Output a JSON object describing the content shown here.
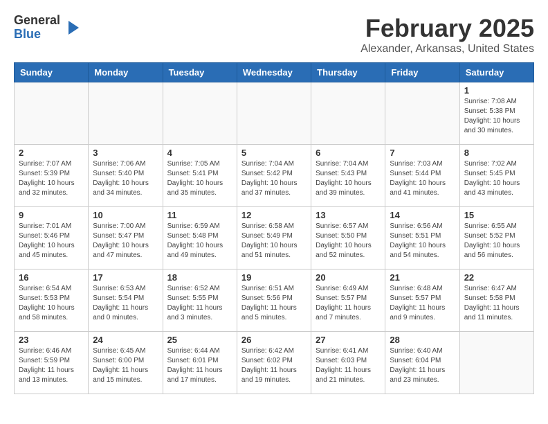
{
  "logo": {
    "general": "General",
    "blue": "Blue"
  },
  "header": {
    "month": "February 2025",
    "location": "Alexander, Arkansas, United States"
  },
  "weekdays": [
    "Sunday",
    "Monday",
    "Tuesday",
    "Wednesday",
    "Thursday",
    "Friday",
    "Saturday"
  ],
  "weeks": [
    [
      {
        "day": "",
        "info": ""
      },
      {
        "day": "",
        "info": ""
      },
      {
        "day": "",
        "info": ""
      },
      {
        "day": "",
        "info": ""
      },
      {
        "day": "",
        "info": ""
      },
      {
        "day": "",
        "info": ""
      },
      {
        "day": "1",
        "info": "Sunrise: 7:08 AM\nSunset: 5:38 PM\nDaylight: 10 hours\nand 30 minutes."
      }
    ],
    [
      {
        "day": "2",
        "info": "Sunrise: 7:07 AM\nSunset: 5:39 PM\nDaylight: 10 hours\nand 32 minutes."
      },
      {
        "day": "3",
        "info": "Sunrise: 7:06 AM\nSunset: 5:40 PM\nDaylight: 10 hours\nand 34 minutes."
      },
      {
        "day": "4",
        "info": "Sunrise: 7:05 AM\nSunset: 5:41 PM\nDaylight: 10 hours\nand 35 minutes."
      },
      {
        "day": "5",
        "info": "Sunrise: 7:04 AM\nSunset: 5:42 PM\nDaylight: 10 hours\nand 37 minutes."
      },
      {
        "day": "6",
        "info": "Sunrise: 7:04 AM\nSunset: 5:43 PM\nDaylight: 10 hours\nand 39 minutes."
      },
      {
        "day": "7",
        "info": "Sunrise: 7:03 AM\nSunset: 5:44 PM\nDaylight: 10 hours\nand 41 minutes."
      },
      {
        "day": "8",
        "info": "Sunrise: 7:02 AM\nSunset: 5:45 PM\nDaylight: 10 hours\nand 43 minutes."
      }
    ],
    [
      {
        "day": "9",
        "info": "Sunrise: 7:01 AM\nSunset: 5:46 PM\nDaylight: 10 hours\nand 45 minutes."
      },
      {
        "day": "10",
        "info": "Sunrise: 7:00 AM\nSunset: 5:47 PM\nDaylight: 10 hours\nand 47 minutes."
      },
      {
        "day": "11",
        "info": "Sunrise: 6:59 AM\nSunset: 5:48 PM\nDaylight: 10 hours\nand 49 minutes."
      },
      {
        "day": "12",
        "info": "Sunrise: 6:58 AM\nSunset: 5:49 PM\nDaylight: 10 hours\nand 51 minutes."
      },
      {
        "day": "13",
        "info": "Sunrise: 6:57 AM\nSunset: 5:50 PM\nDaylight: 10 hours\nand 52 minutes."
      },
      {
        "day": "14",
        "info": "Sunrise: 6:56 AM\nSunset: 5:51 PM\nDaylight: 10 hours\nand 54 minutes."
      },
      {
        "day": "15",
        "info": "Sunrise: 6:55 AM\nSunset: 5:52 PM\nDaylight: 10 hours\nand 56 minutes."
      }
    ],
    [
      {
        "day": "16",
        "info": "Sunrise: 6:54 AM\nSunset: 5:53 PM\nDaylight: 10 hours\nand 58 minutes."
      },
      {
        "day": "17",
        "info": "Sunrise: 6:53 AM\nSunset: 5:54 PM\nDaylight: 11 hours\nand 0 minutes."
      },
      {
        "day": "18",
        "info": "Sunrise: 6:52 AM\nSunset: 5:55 PM\nDaylight: 11 hours\nand 3 minutes."
      },
      {
        "day": "19",
        "info": "Sunrise: 6:51 AM\nSunset: 5:56 PM\nDaylight: 11 hours\nand 5 minutes."
      },
      {
        "day": "20",
        "info": "Sunrise: 6:49 AM\nSunset: 5:57 PM\nDaylight: 11 hours\nand 7 minutes."
      },
      {
        "day": "21",
        "info": "Sunrise: 6:48 AM\nSunset: 5:57 PM\nDaylight: 11 hours\nand 9 minutes."
      },
      {
        "day": "22",
        "info": "Sunrise: 6:47 AM\nSunset: 5:58 PM\nDaylight: 11 hours\nand 11 minutes."
      }
    ],
    [
      {
        "day": "23",
        "info": "Sunrise: 6:46 AM\nSunset: 5:59 PM\nDaylight: 11 hours\nand 13 minutes."
      },
      {
        "day": "24",
        "info": "Sunrise: 6:45 AM\nSunset: 6:00 PM\nDaylight: 11 hours\nand 15 minutes."
      },
      {
        "day": "25",
        "info": "Sunrise: 6:44 AM\nSunset: 6:01 PM\nDaylight: 11 hours\nand 17 minutes."
      },
      {
        "day": "26",
        "info": "Sunrise: 6:42 AM\nSunset: 6:02 PM\nDaylight: 11 hours\nand 19 minutes."
      },
      {
        "day": "27",
        "info": "Sunrise: 6:41 AM\nSunset: 6:03 PM\nDaylight: 11 hours\nand 21 minutes."
      },
      {
        "day": "28",
        "info": "Sunrise: 6:40 AM\nSunset: 6:04 PM\nDaylight: 11 hours\nand 23 minutes."
      },
      {
        "day": "",
        "info": ""
      }
    ]
  ]
}
